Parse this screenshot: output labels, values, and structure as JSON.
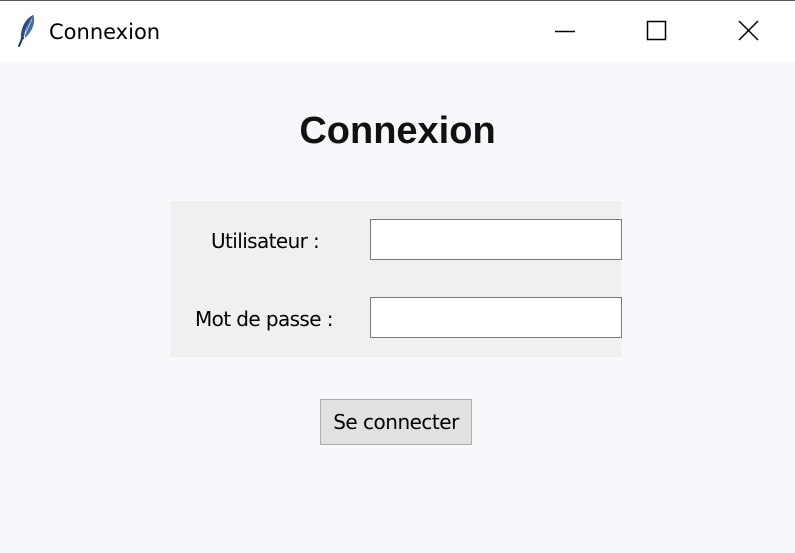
{
  "window": {
    "title": "Connexion",
    "icon": "feather-icon",
    "controls": [
      "minimize-icon",
      "maximize-icon",
      "close-icon"
    ]
  },
  "main": {
    "heading": "Connexion",
    "fields": [
      {
        "label": "Utilisateur :",
        "value": "",
        "placeholder": ""
      },
      {
        "label": "Mot de passe :",
        "value": "",
        "placeholder": ""
      }
    ],
    "submit_label": "Se connecter"
  },
  "colors": {
    "background": "#f7f8fb",
    "form_panel": "#f0f0f0",
    "button": "#e1e1e1"
  }
}
